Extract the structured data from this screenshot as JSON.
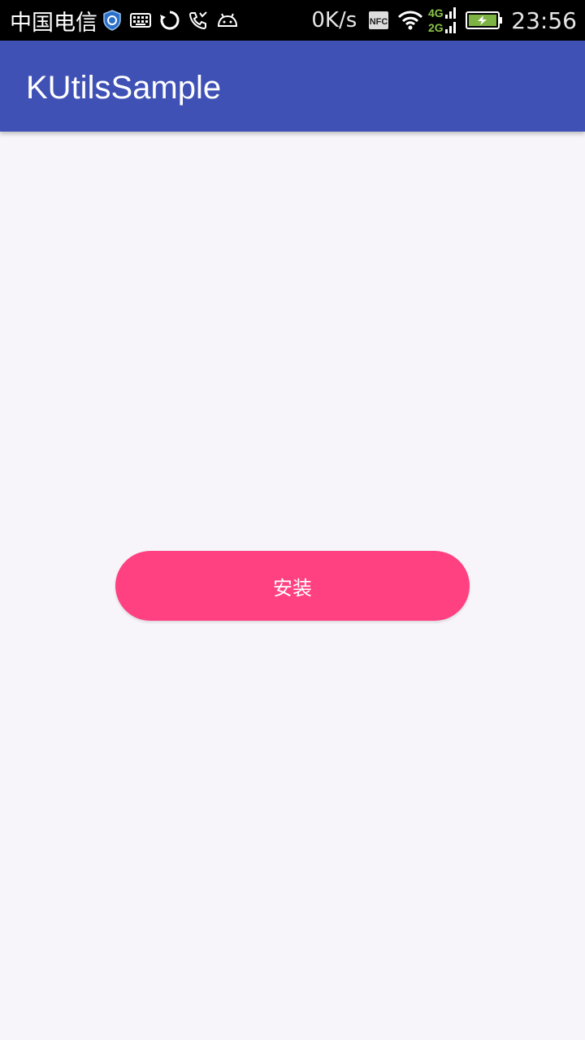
{
  "status_bar": {
    "carrier": "中国电信",
    "network_speed": "0K/s",
    "nfc_label": "NFC",
    "network_4g": "4G",
    "network_2g": "2G",
    "time": "23:56",
    "icons": [
      "shield-app-icon",
      "keyboard-icon",
      "sync-icon",
      "missed-call-icon",
      "android-debug-icon",
      "nfc-icon",
      "wifi-icon",
      "cellular-signal-icon",
      "battery-charging-icon"
    ],
    "colors": {
      "background": "#000000",
      "network_type": "#8BC34A",
      "battery_fill": "#7CB342"
    }
  },
  "app_bar": {
    "title": "KUtilsSample",
    "color": "#3F51B5"
  },
  "main": {
    "install_button_label": "安装",
    "button_color": "#FF4081",
    "background": "#F7F5FA"
  }
}
